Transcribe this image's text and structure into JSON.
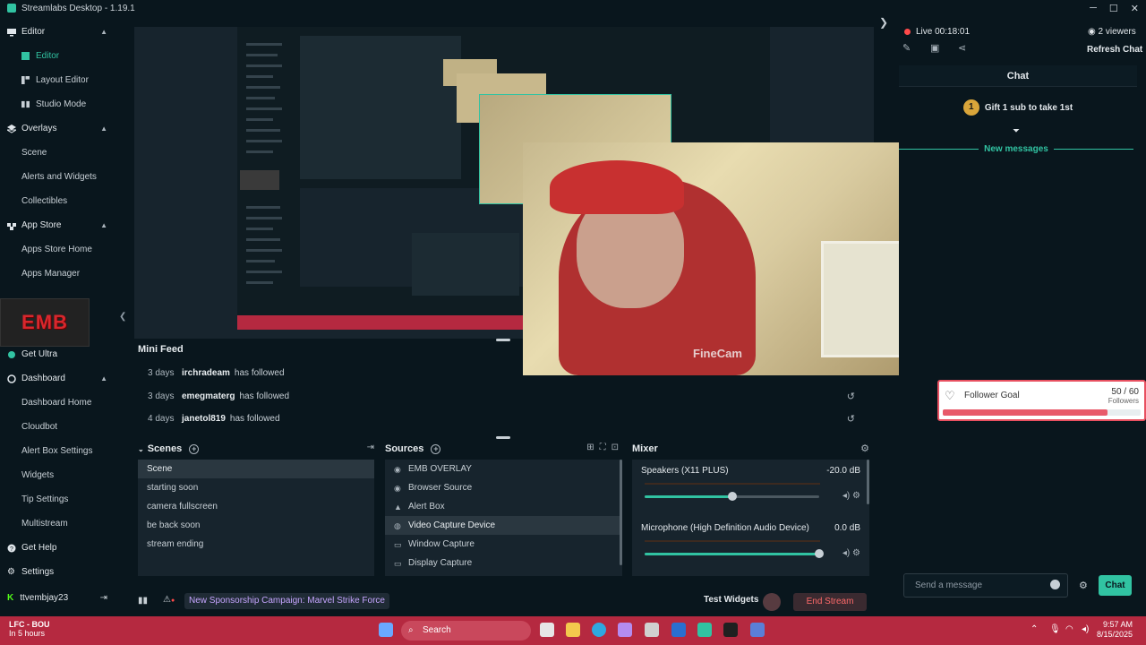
{
  "window": {
    "title": "Streamlabs Desktop - 1.19.1",
    "controls": [
      "─",
      "☐",
      "✕"
    ]
  },
  "sidebar": {
    "sections": [
      {
        "label": "Editor",
        "icon": "monitor-icon",
        "items": [
          {
            "label": "Editor",
            "active": true
          },
          {
            "label": "Layout Editor"
          },
          {
            "label": "Studio Mode"
          }
        ]
      },
      {
        "label": "Overlays",
        "icon": "layers-icon",
        "items": [
          {
            "label": "Scene"
          },
          {
            "label": "Alerts and Widgets"
          },
          {
            "label": "Collectibles"
          }
        ]
      },
      {
        "label": "App Store",
        "icon": "store-icon",
        "items": [
          {
            "label": "Apps Store Home"
          },
          {
            "label": "Apps Manager"
          }
        ]
      },
      {
        "label": "Get Ultra",
        "icon": "ultra-icon",
        "items": []
      },
      {
        "label": "Dashboard",
        "icon": "dashboard-icon",
        "items": [
          {
            "label": "Dashboard Home"
          },
          {
            "label": "Cloudbot"
          },
          {
            "label": "Alert Box Settings"
          },
          {
            "label": "Widgets"
          },
          {
            "label": "Tip Settings"
          },
          {
            "label": "Multistream"
          }
        ]
      },
      {
        "label": "Get Help",
        "icon": "help-icon",
        "items": []
      },
      {
        "label": "Settings",
        "icon": "gear-icon",
        "items": []
      }
    ],
    "logo_text": "EMB",
    "username": "ttvembjay23"
  },
  "preview": {
    "cam_watermark": "FineCam"
  },
  "minifeed": {
    "title": "Mini Feed",
    "rows": [
      {
        "age": "3 days",
        "who": "irchradeam",
        "action": "has followed"
      },
      {
        "age": "3 days",
        "who": "emegmaterg",
        "action": "has followed"
      },
      {
        "age": "4 days",
        "who": "janetol819",
        "action": "has followed"
      }
    ]
  },
  "scenes": {
    "title": "Scenes",
    "items": [
      "Scene",
      "starting soon",
      "camera fullscreen",
      "be back soon",
      "stream ending"
    ],
    "selected": 0
  },
  "sources": {
    "title": "Sources",
    "items": [
      {
        "label": "EMB OVERLAY",
        "icon": "globe-icon"
      },
      {
        "label": "Browser Source",
        "icon": "globe-icon"
      },
      {
        "label": "Alert Box",
        "icon": "bell-icon"
      },
      {
        "label": "Video Capture Device",
        "icon": "camera-icon"
      },
      {
        "label": "Window Capture",
        "icon": "window-icon"
      },
      {
        "label": "Display Capture",
        "icon": "display-icon"
      }
    ],
    "selected": 3
  },
  "mixer": {
    "title": "Mixer",
    "channels": [
      {
        "name": "Speakers (X11 PLUS)",
        "db": "-20.0 dB",
        "level": 0.5
      },
      {
        "name": "Microphone (High Definition Audio Device)",
        "db": "0.0 dB",
        "level": 1.0
      }
    ]
  },
  "footer": {
    "campaign": "New Sponsorship Campaign: Marvel Strike Force",
    "test_widgets": "Test Widgets",
    "end_stream": "End Stream"
  },
  "chat": {
    "live": "Live 00:18:01",
    "viewers": "2 viewers",
    "refresh": "Refresh Chat",
    "header": "Chat",
    "gift_badge": "1",
    "gift_text": "Gift 1 sub to take 1st",
    "new_messages": "New messages",
    "placeholder": "Send a message",
    "send": "Chat"
  },
  "follower_goal": {
    "label": "Follower Goal",
    "count": "50 / 60",
    "unit": "Followers",
    "progress": 0.833
  },
  "taskbar": {
    "news_title": "LFC - BOU",
    "news_sub": "In 5 hours",
    "search": "Search",
    "time": "9:57 AM",
    "date": "8/15/2025"
  },
  "colors": {
    "accent": "#31c3a2",
    "background": "#09161d",
    "panel": "#17242d",
    "live": "#ff4a4a",
    "taskbar": "#b52940"
  }
}
